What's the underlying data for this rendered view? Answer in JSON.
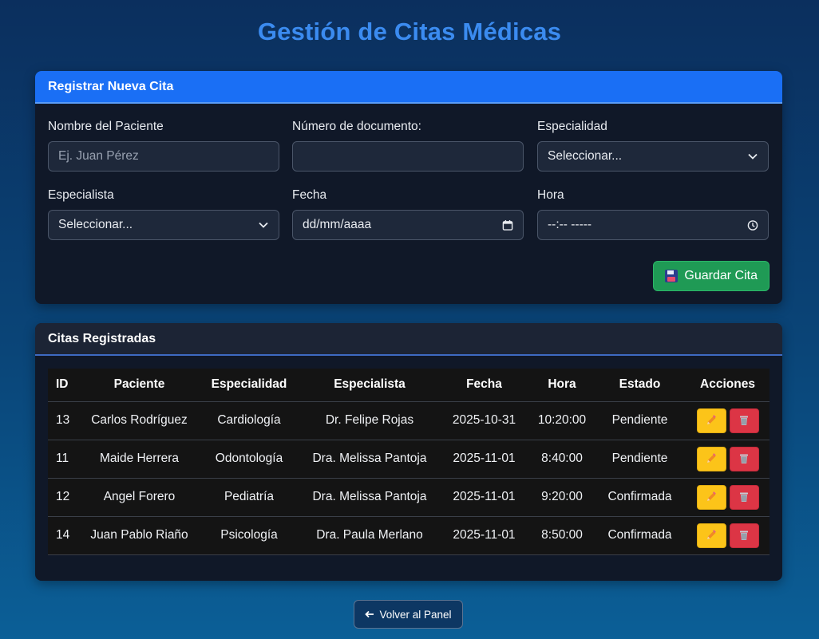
{
  "page": {
    "title": "Gestión de Citas Médicas"
  },
  "form": {
    "header": "Registrar Nueva Cita",
    "fields": {
      "patient": {
        "label": "Nombre del Paciente",
        "placeholder": "Ej. Juan Pérez",
        "value": ""
      },
      "document": {
        "label": "Número de documento:",
        "value": ""
      },
      "specialty": {
        "label": "Especialidad",
        "value": "Seleccionar..."
      },
      "specialist": {
        "label": "Especialista",
        "value": "Seleccionar..."
      },
      "date": {
        "label": "Fecha",
        "value": "dd/mm/aaaa"
      },
      "time": {
        "label": "Hora",
        "value": "--:-- -----"
      }
    },
    "save_label": "Guardar Cita"
  },
  "appointments": {
    "header": "Citas Registradas",
    "columns": [
      "ID",
      "Paciente",
      "Especialidad",
      "Especialista",
      "Fecha",
      "Hora",
      "Estado",
      "Acciones"
    ],
    "rows": [
      {
        "id": "13",
        "patient": "Carlos Rodríguez",
        "specialty": "Cardiología",
        "specialist": "Dr. Felipe Rojas",
        "date": "2025-10-31",
        "time": "10:20:00",
        "status": "Pendiente"
      },
      {
        "id": "11",
        "patient": "Maide Herrera",
        "specialty": "Odontología",
        "specialist": "Dra. Melissa Pantoja",
        "date": "2025-11-01",
        "time": "8:40:00",
        "status": "Pendiente"
      },
      {
        "id": "12",
        "patient": "Angel Forero",
        "specialty": "Pediatría",
        "specialist": "Dra. Melissa Pantoja",
        "date": "2025-11-01",
        "time": "9:20:00",
        "status": "Confirmada"
      },
      {
        "id": "14",
        "patient": "Juan Pablo Riaño",
        "specialty": "Psicología",
        "specialist": "Dra. Paula Merlano",
        "date": "2025-11-01",
        "time": "8:50:00",
        "status": "Confirmada"
      }
    ]
  },
  "footer": {
    "back_label": "Volver al Panel"
  },
  "colors": {
    "title": "#3b8bf0",
    "primary": "#1a6ff5",
    "success": "#1f9a55",
    "warning": "#fcc419",
    "danger": "#dc3545"
  },
  "icons": {
    "save": "floppy-disk-icon",
    "edit": "pencil-icon",
    "delete": "trash-icon",
    "back": "arrow-left-icon",
    "select": "chevron-down-icon",
    "date": "calendar-icon",
    "time": "clock-icon"
  }
}
